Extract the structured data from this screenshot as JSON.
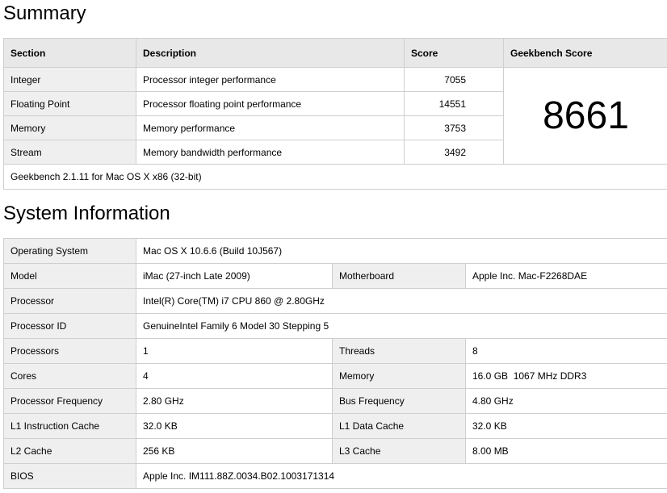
{
  "summary": {
    "title": "Summary",
    "headers": {
      "section": "Section",
      "description": "Description",
      "score": "Score",
      "geekbench_score": "Geekbench Score"
    },
    "rows": [
      {
        "section": "Integer",
        "description": "Processor integer performance",
        "score": "7055"
      },
      {
        "section": "Floating Point",
        "description": "Processor floating point performance",
        "score": "14551"
      },
      {
        "section": "Memory",
        "description": "Memory performance",
        "score": "3753"
      },
      {
        "section": "Stream",
        "description": "Memory bandwidth performance",
        "score": "3492"
      }
    ],
    "geekbench_score_value": "8661",
    "footer": "Geekbench 2.1.11 for Mac OS X x86 (32-bit)"
  },
  "system_info": {
    "title": "System Information",
    "operating_system": {
      "label": "Operating System",
      "value": "Mac OS X 10.6.6 (Build 10J567)"
    },
    "model": {
      "label": "Model",
      "value": "iMac (27-inch Late 2009)"
    },
    "motherboard": {
      "label": "Motherboard",
      "value": "Apple Inc. Mac-F2268DAE"
    },
    "processor": {
      "label": "Processor",
      "value": "Intel(R) Core(TM) i7 CPU 860 @ 2.80GHz"
    },
    "processor_id": {
      "label": "Processor ID",
      "value": "GenuineIntel Family 6 Model 30 Stepping 5"
    },
    "processors": {
      "label": "Processors",
      "value": "1"
    },
    "threads": {
      "label": "Threads",
      "value": "8"
    },
    "cores": {
      "label": "Cores",
      "value": "4"
    },
    "memory": {
      "label": "Memory",
      "value": "16.0 GB  1067 MHz DDR3"
    },
    "processor_frequency": {
      "label": "Processor Frequency",
      "value": "2.80 GHz"
    },
    "bus_frequency": {
      "label": "Bus Frequency",
      "value": "4.80 GHz"
    },
    "l1_instruction_cache": {
      "label": "L1 Instruction Cache",
      "value": "32.0 KB"
    },
    "l1_data_cache": {
      "label": "L1 Data Cache",
      "value": "32.0 KB"
    },
    "l2_cache": {
      "label": "L2 Cache",
      "value": "256 KB"
    },
    "l3_cache": {
      "label": "L3 Cache",
      "value": "8.00 MB"
    },
    "bios": {
      "label": "BIOS",
      "value": "Apple Inc. IM111.88Z.0034.B02.1003171314"
    }
  }
}
